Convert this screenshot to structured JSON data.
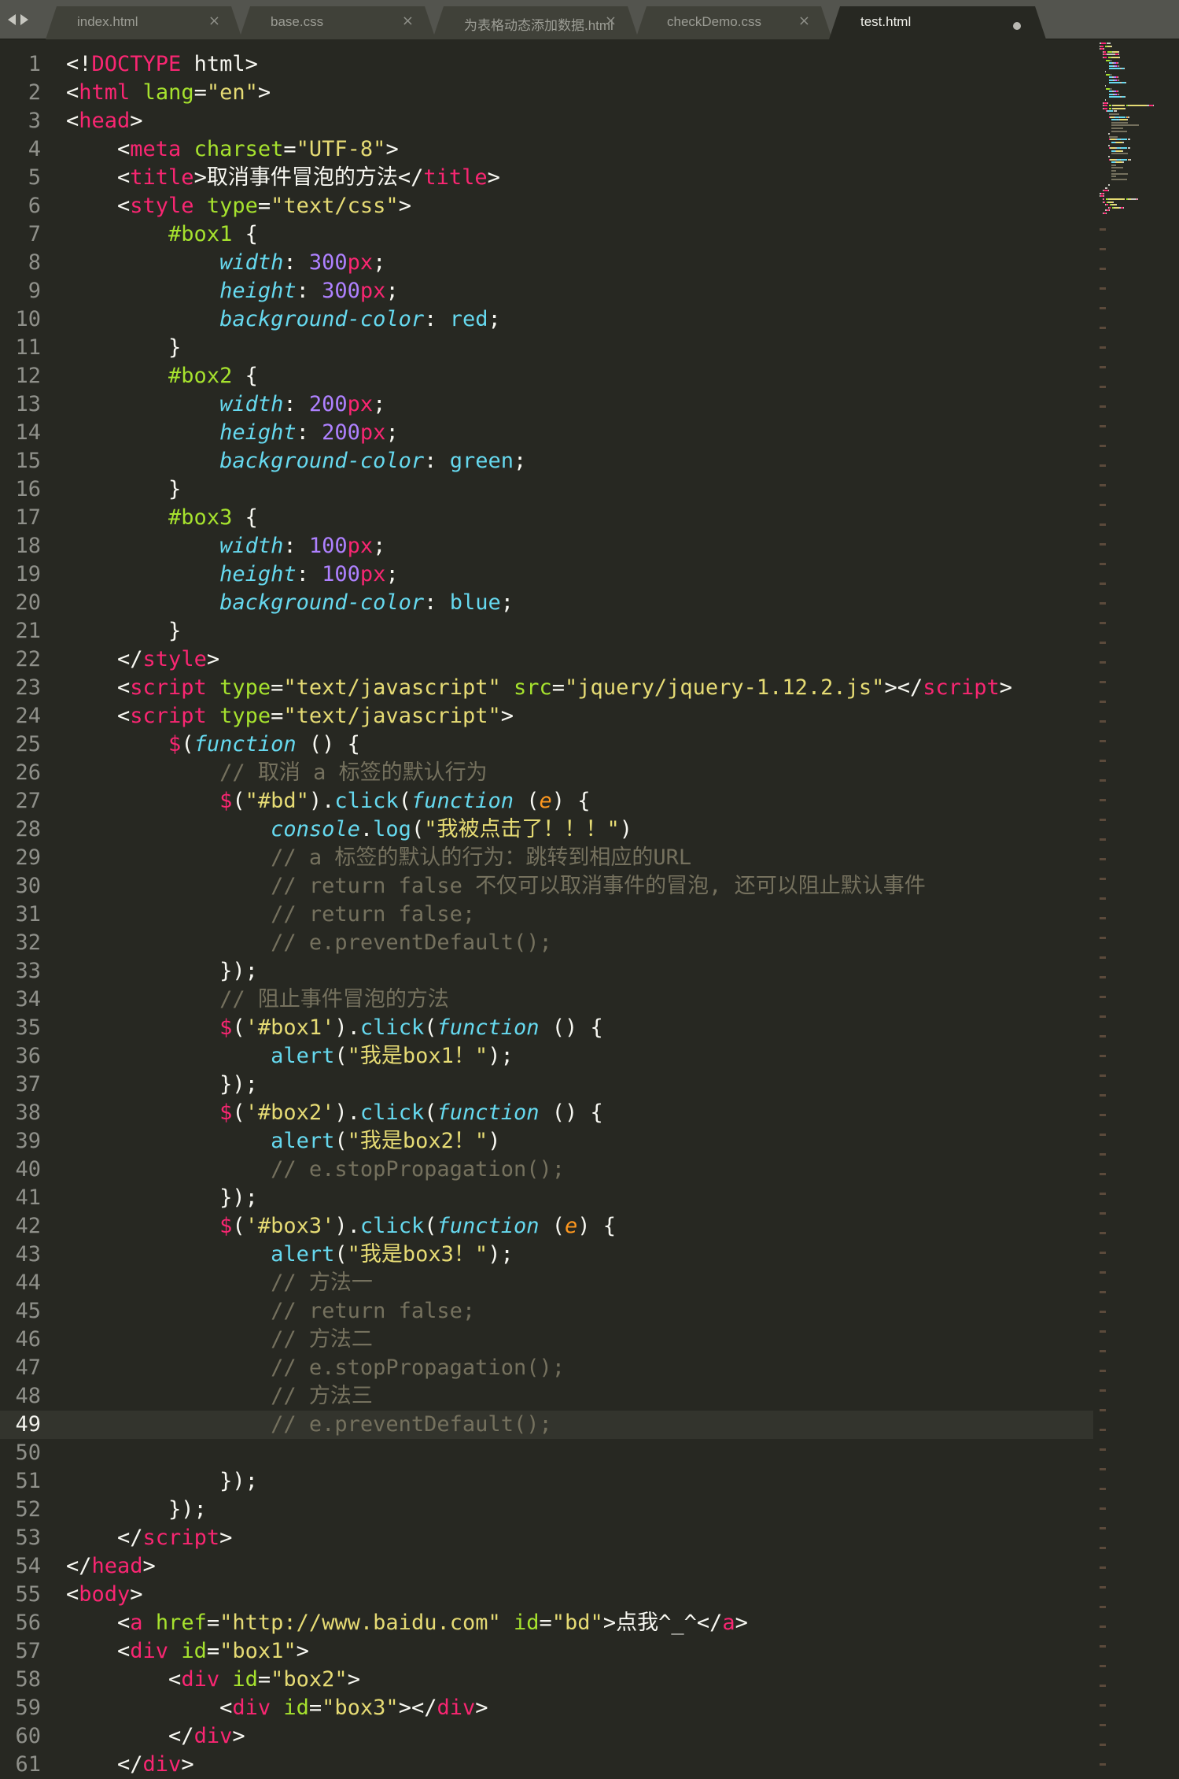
{
  "tabs": [
    {
      "label": "index.html",
      "close": "×",
      "active": false
    },
    {
      "label": "base.css",
      "close": "×",
      "active": false
    },
    {
      "label": "为表格动态添加数据.html",
      "close": "×",
      "active": false
    },
    {
      "label": "checkDemo.css",
      "close": "×",
      "active": false
    },
    {
      "label": "test.html",
      "close": "",
      "active": true,
      "unsaved": true
    }
  ],
  "active_line": 49,
  "lines": [
    [
      [
        "punc",
        "<!"
      ],
      [
        "tag",
        "DOCTYPE"
      ],
      [
        "punc",
        " html>"
      ]
    ],
    [
      [
        "punc",
        "<"
      ],
      [
        "tag",
        "html"
      ],
      [
        "punc",
        " "
      ],
      [
        "attr",
        "lang"
      ],
      [
        "punc",
        "="
      ],
      [
        "str",
        "\"en\""
      ],
      [
        "punc",
        ">"
      ]
    ],
    [
      [
        "punc",
        "<"
      ],
      [
        "tag",
        "head"
      ],
      [
        "punc",
        ">"
      ]
    ],
    [
      [
        "punc",
        "    <"
      ],
      [
        "tag",
        "meta"
      ],
      [
        "punc",
        " "
      ],
      [
        "attr",
        "charset"
      ],
      [
        "punc",
        "="
      ],
      [
        "str",
        "\"UTF-8\""
      ],
      [
        "punc",
        ">"
      ]
    ],
    [
      [
        "punc",
        "    <"
      ],
      [
        "tag",
        "title"
      ],
      [
        "punc",
        ">取消事件冒泡的方法</"
      ],
      [
        "tag",
        "title"
      ],
      [
        "punc",
        ">"
      ]
    ],
    [
      [
        "punc",
        "    <"
      ],
      [
        "tag",
        "style"
      ],
      [
        "punc",
        " "
      ],
      [
        "attr",
        "type"
      ],
      [
        "punc",
        "="
      ],
      [
        "str",
        "\"text/css\""
      ],
      [
        "punc",
        ">"
      ]
    ],
    [
      [
        "punc",
        "        "
      ],
      [
        "sel",
        "#box1"
      ],
      [
        "punc",
        " {"
      ]
    ],
    [
      [
        "punc",
        "            "
      ],
      [
        "prop",
        "width"
      ],
      [
        "punc",
        ": "
      ],
      [
        "num",
        "300"
      ],
      [
        "unit",
        "px"
      ],
      [
        "punc",
        ";"
      ]
    ],
    [
      [
        "punc",
        "            "
      ],
      [
        "prop",
        "height"
      ],
      [
        "punc",
        ": "
      ],
      [
        "num",
        "300"
      ],
      [
        "unit",
        "px"
      ],
      [
        "punc",
        ";"
      ]
    ],
    [
      [
        "punc",
        "            "
      ],
      [
        "prop",
        "background-color"
      ],
      [
        "punc",
        ": "
      ],
      [
        "val",
        "red"
      ],
      [
        "punc",
        ";"
      ]
    ],
    [
      [
        "punc",
        "        }"
      ]
    ],
    [
      [
        "punc",
        "        "
      ],
      [
        "sel",
        "#box2"
      ],
      [
        "punc",
        " {"
      ]
    ],
    [
      [
        "punc",
        "            "
      ],
      [
        "prop",
        "width"
      ],
      [
        "punc",
        ": "
      ],
      [
        "num",
        "200"
      ],
      [
        "unit",
        "px"
      ],
      [
        "punc",
        ";"
      ]
    ],
    [
      [
        "punc",
        "            "
      ],
      [
        "prop",
        "height"
      ],
      [
        "punc",
        ": "
      ],
      [
        "num",
        "200"
      ],
      [
        "unit",
        "px"
      ],
      [
        "punc",
        ";"
      ]
    ],
    [
      [
        "punc",
        "            "
      ],
      [
        "prop",
        "background-color"
      ],
      [
        "punc",
        ": "
      ],
      [
        "val",
        "green"
      ],
      [
        "punc",
        ";"
      ]
    ],
    [
      [
        "punc",
        "        }"
      ]
    ],
    [
      [
        "punc",
        "        "
      ],
      [
        "sel",
        "#box3"
      ],
      [
        "punc",
        " {"
      ]
    ],
    [
      [
        "punc",
        "            "
      ],
      [
        "prop",
        "width"
      ],
      [
        "punc",
        ": "
      ],
      [
        "num",
        "100"
      ],
      [
        "unit",
        "px"
      ],
      [
        "punc",
        ";"
      ]
    ],
    [
      [
        "punc",
        "            "
      ],
      [
        "prop",
        "height"
      ],
      [
        "punc",
        ": "
      ],
      [
        "num",
        "100"
      ],
      [
        "unit",
        "px"
      ],
      [
        "punc",
        ";"
      ]
    ],
    [
      [
        "punc",
        "            "
      ],
      [
        "prop",
        "background-color"
      ],
      [
        "punc",
        ": "
      ],
      [
        "val",
        "blue"
      ],
      [
        "punc",
        ";"
      ]
    ],
    [
      [
        "punc",
        "        }"
      ]
    ],
    [
      [
        "punc",
        "    </"
      ],
      [
        "tag",
        "style"
      ],
      [
        "punc",
        ">"
      ]
    ],
    [
      [
        "punc",
        "    <"
      ],
      [
        "tag",
        "script"
      ],
      [
        "punc",
        " "
      ],
      [
        "attr",
        "type"
      ],
      [
        "punc",
        "="
      ],
      [
        "str",
        "\"text/javascript\""
      ],
      [
        "punc",
        " "
      ],
      [
        "attr",
        "src"
      ],
      [
        "punc",
        "="
      ],
      [
        "str",
        "\"jquery/jquery-1.12.2.js\""
      ],
      [
        "punc",
        "></"
      ],
      [
        "tag",
        "script"
      ],
      [
        "punc",
        ">"
      ]
    ],
    [
      [
        "punc",
        "    <"
      ],
      [
        "tag",
        "script"
      ],
      [
        "punc",
        " "
      ],
      [
        "attr",
        "type"
      ],
      [
        "punc",
        "="
      ],
      [
        "str",
        "\"text/javascript\""
      ],
      [
        "punc",
        ">"
      ]
    ],
    [
      [
        "punc",
        "        "
      ],
      [
        "dollar",
        "$"
      ],
      [
        "punc",
        "("
      ],
      [
        "kw",
        "function"
      ],
      [
        "punc",
        " () {"
      ]
    ],
    [
      [
        "punc",
        "            "
      ],
      [
        "cmt",
        "// 取消 a 标签的默认行为"
      ]
    ],
    [
      [
        "punc",
        "            "
      ],
      [
        "dollar",
        "$"
      ],
      [
        "punc",
        "("
      ],
      [
        "str",
        "\"#bd\""
      ],
      [
        "punc",
        ")."
      ],
      [
        "fn",
        "click"
      ],
      [
        "punc",
        "("
      ],
      [
        "kw",
        "function"
      ],
      [
        "punc",
        " ("
      ],
      [
        "param",
        "e"
      ],
      [
        "punc",
        ") {"
      ]
    ],
    [
      [
        "punc",
        "                "
      ],
      [
        "kw",
        "console"
      ],
      [
        "punc",
        "."
      ],
      [
        "fn",
        "log"
      ],
      [
        "punc",
        "("
      ],
      [
        "str",
        "\"我被点击了！！！\""
      ],
      [
        "punc",
        ")"
      ]
    ],
    [
      [
        "punc",
        "                "
      ],
      [
        "cmt",
        "// a 标签的默认的行为：跳转到相应的URL"
      ]
    ],
    [
      [
        "punc",
        "                "
      ],
      [
        "cmt",
        "// return false 不仅可以取消事件的冒泡, 还可以阻止默认事件"
      ]
    ],
    [
      [
        "punc",
        "                "
      ],
      [
        "cmt",
        "// return false;"
      ]
    ],
    [
      [
        "punc",
        "                "
      ],
      [
        "cmt",
        "// e.preventDefault();"
      ]
    ],
    [
      [
        "punc",
        "            });"
      ]
    ],
    [
      [
        "punc",
        "            "
      ],
      [
        "cmt",
        "// 阻止事件冒泡的方法"
      ]
    ],
    [
      [
        "punc",
        "            "
      ],
      [
        "dollar",
        "$"
      ],
      [
        "punc",
        "("
      ],
      [
        "str",
        "'#box1'"
      ],
      [
        "punc",
        ")."
      ],
      [
        "fn",
        "click"
      ],
      [
        "punc",
        "("
      ],
      [
        "kw",
        "function"
      ],
      [
        "punc",
        " () {"
      ]
    ],
    [
      [
        "punc",
        "                "
      ],
      [
        "fn",
        "alert"
      ],
      [
        "punc",
        "("
      ],
      [
        "str",
        "\"我是box1！\""
      ],
      [
        "punc",
        ");"
      ]
    ],
    [
      [
        "punc",
        "            });"
      ]
    ],
    [
      [
        "punc",
        "            "
      ],
      [
        "dollar",
        "$"
      ],
      [
        "punc",
        "("
      ],
      [
        "str",
        "'#box2'"
      ],
      [
        "punc",
        ")."
      ],
      [
        "fn",
        "click"
      ],
      [
        "punc",
        "("
      ],
      [
        "kw",
        "function"
      ],
      [
        "punc",
        " () {"
      ]
    ],
    [
      [
        "punc",
        "                "
      ],
      [
        "fn",
        "alert"
      ],
      [
        "punc",
        "("
      ],
      [
        "str",
        "\"我是box2！\""
      ],
      [
        "punc",
        ")"
      ]
    ],
    [
      [
        "punc",
        "                "
      ],
      [
        "cmt",
        "// e.stopPropagation();"
      ]
    ],
    [
      [
        "punc",
        "            });"
      ]
    ],
    [
      [
        "punc",
        "            "
      ],
      [
        "dollar",
        "$"
      ],
      [
        "punc",
        "("
      ],
      [
        "str",
        "'#box3'"
      ],
      [
        "punc",
        ")."
      ],
      [
        "fn",
        "click"
      ],
      [
        "punc",
        "("
      ],
      [
        "kw",
        "function"
      ],
      [
        "punc",
        " ("
      ],
      [
        "param",
        "e"
      ],
      [
        "punc",
        ") {"
      ]
    ],
    [
      [
        "punc",
        "                "
      ],
      [
        "fn",
        "alert"
      ],
      [
        "punc",
        "("
      ],
      [
        "str",
        "\"我是box3！\""
      ],
      [
        "punc",
        ");"
      ]
    ],
    [
      [
        "punc",
        "                "
      ],
      [
        "cmt",
        "// 方法一"
      ]
    ],
    [
      [
        "punc",
        "                "
      ],
      [
        "cmt",
        "// return false;"
      ]
    ],
    [
      [
        "punc",
        "                "
      ],
      [
        "cmt",
        "// 方法二"
      ]
    ],
    [
      [
        "punc",
        "                "
      ],
      [
        "cmt",
        "// e.stopPropagation();"
      ]
    ],
    [
      [
        "punc",
        "                "
      ],
      [
        "cmt",
        "// 方法三"
      ]
    ],
    [
      [
        "punc",
        "                "
      ],
      [
        "cmt",
        "// e.preventDefault();"
      ]
    ],
    [],
    [
      [
        "punc",
        "            });"
      ]
    ],
    [
      [
        "punc",
        "        });"
      ]
    ],
    [
      [
        "punc",
        "    </"
      ],
      [
        "tag",
        "script"
      ],
      [
        "punc",
        ">"
      ]
    ],
    [
      [
        "punc",
        "</"
      ],
      [
        "tag",
        "head"
      ],
      [
        "punc",
        ">"
      ]
    ],
    [
      [
        "punc",
        "<"
      ],
      [
        "tag",
        "body"
      ],
      [
        "punc",
        ">"
      ]
    ],
    [
      [
        "punc",
        "    <"
      ],
      [
        "tag",
        "a"
      ],
      [
        "punc",
        " "
      ],
      [
        "attr",
        "href"
      ],
      [
        "punc",
        "="
      ],
      [
        "str",
        "\"http://www.baidu.com\""
      ],
      [
        "punc",
        " "
      ],
      [
        "attr",
        "id"
      ],
      [
        "punc",
        "="
      ],
      [
        "str",
        "\"bd\""
      ],
      [
        "punc",
        ">点我^_^</"
      ],
      [
        "tag",
        "a"
      ],
      [
        "punc",
        ">"
      ]
    ],
    [
      [
        "punc",
        "    <"
      ],
      [
        "tag",
        "div"
      ],
      [
        "punc",
        " "
      ],
      [
        "attr",
        "id"
      ],
      [
        "punc",
        "="
      ],
      [
        "str",
        "\"box1\""
      ],
      [
        "punc",
        ">"
      ]
    ],
    [
      [
        "punc",
        "        <"
      ],
      [
        "tag",
        "div"
      ],
      [
        "punc",
        " "
      ],
      [
        "attr",
        "id"
      ],
      [
        "punc",
        "="
      ],
      [
        "str",
        "\"box2\""
      ],
      [
        "punc",
        ">"
      ]
    ],
    [
      [
        "punc",
        "            <"
      ],
      [
        "tag",
        "div"
      ],
      [
        "punc",
        " "
      ],
      [
        "attr",
        "id"
      ],
      [
        "punc",
        "="
      ],
      [
        "str",
        "\"box3\""
      ],
      [
        "punc",
        "></"
      ],
      [
        "tag",
        "div"
      ],
      [
        "punc",
        ">"
      ]
    ],
    [
      [
        "punc",
        "        </"
      ],
      [
        "tag",
        "div"
      ],
      [
        "punc",
        ">"
      ]
    ],
    [
      [
        "punc",
        "    </"
      ],
      [
        "tag",
        "div"
      ],
      [
        "punc",
        ">"
      ]
    ]
  ],
  "colors": {
    "background": "#272822",
    "tag": "#f92672",
    "attribute": "#a6e22e",
    "string": "#e6db74",
    "property": "#66d9ef",
    "number": "#ae81ff",
    "comment": "#75715e",
    "parameter": "#fd971f",
    "text": "#f8f8f2"
  },
  "icons": {
    "nav_back": "arrow-left-icon",
    "nav_forward": "arrow-right-icon",
    "close": "close-icon",
    "unsaved": "unsaved-dot-icon"
  }
}
